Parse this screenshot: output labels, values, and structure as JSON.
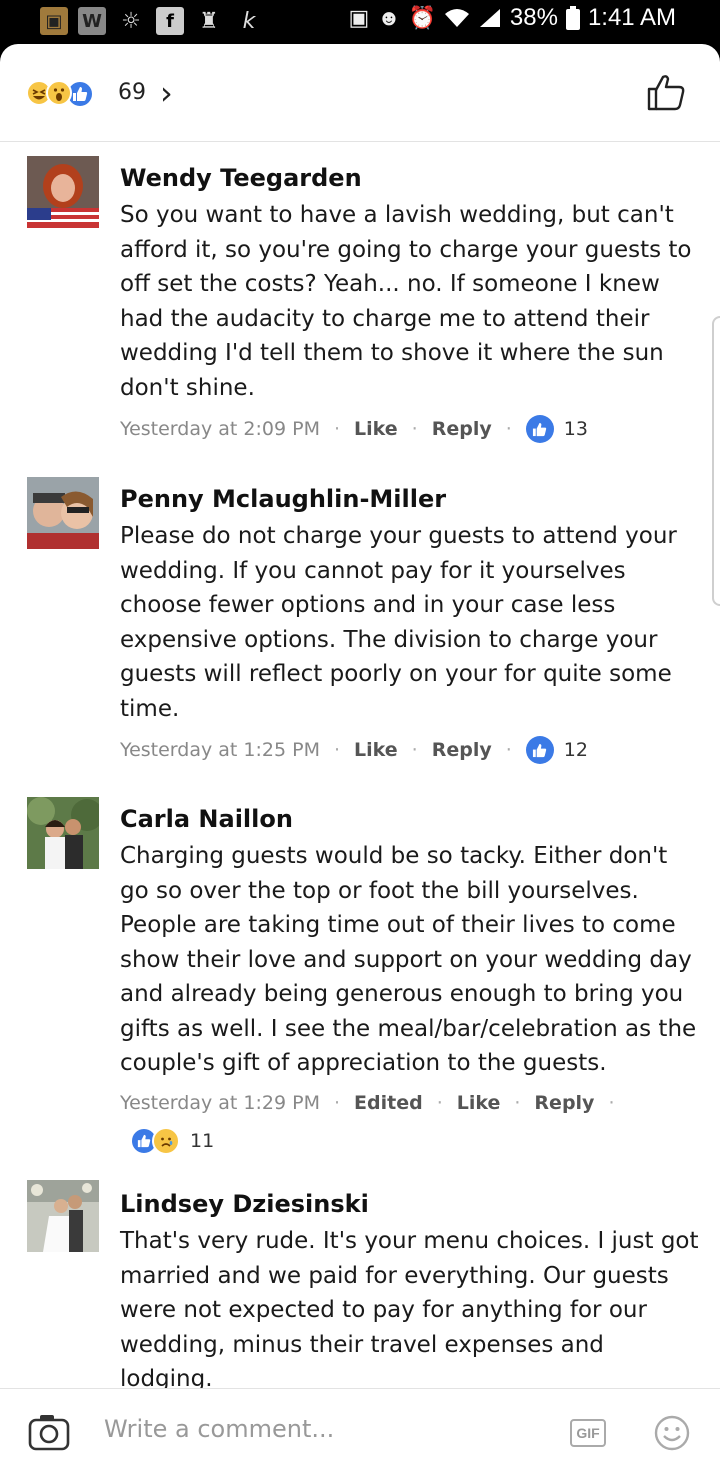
{
  "status_bar": {
    "battery": "38%",
    "time": "1:41 AM",
    "left_icons": [
      "app-icon",
      "word-icon",
      "sun-icon",
      "facebook-icon",
      "person-icon",
      "k-icon"
    ],
    "right_icons": [
      "vpn-icon",
      "person-badge-icon",
      "alarm-icon",
      "wifi-icon",
      "signal-icon",
      "battery-icon"
    ]
  },
  "reactions_header": {
    "count": "69",
    "icons": [
      "haha-icon",
      "wow-icon",
      "like-icon"
    ]
  },
  "comments": [
    {
      "name": "Wendy Teegarden",
      "text": "So you want to have a lavish wedding, but can't afford it, so you're going to charge your guests to off set the costs? Yeah... no. If someone I knew had the audacity to charge me to attend their wedding I'd tell them to shove it where the sun don't shine.",
      "time": "Yesterday at 2:09 PM",
      "like": "Like",
      "reply": "Reply",
      "reactions": "13"
    },
    {
      "name": "Penny Mclaughlin-Miller",
      "text": "Please do not charge your guests to attend your wedding. If you cannot pay for it yourselves choose fewer options and in your case less expensive options. The division to charge your guests will reflect poorly on your for quite some time.",
      "time": "Yesterday at 1:25 PM",
      "like": "Like",
      "reply": "Reply",
      "reactions": "12"
    },
    {
      "name": "Carla Naillon",
      "text": "Charging guests would be so tacky. Either don't go so over the top or foot the bill yourselves. People are taking time out of their lives to come show their love and support on your wedding day and already being generous enough to bring you gifts as well. I see the meal/bar/celebration as the couple's gift of appreciation to the guests.",
      "time": "Yesterday at 1:29 PM",
      "edited": "Edited",
      "like": "Like",
      "reply": "Reply",
      "reactions": "11"
    },
    {
      "name": "Lindsey Dziesinski",
      "text": "That's very rude. It's your menu choices. I just got married and we paid for everything. Our guests were not expected to pay for anything for our wedding, minus their travel expenses and lodging."
    }
  ],
  "composer": {
    "placeholder": "Write a comment...",
    "gif_label": "GIF"
  },
  "colors": {
    "like_blue": "#3b7ae6",
    "emoji_yellow": "#f7c545"
  }
}
